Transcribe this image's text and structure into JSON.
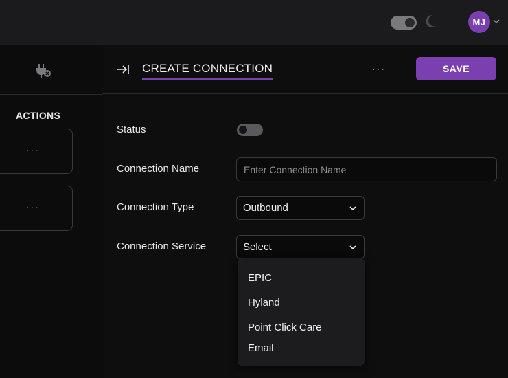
{
  "topbar": {
    "avatar_initials": "MJ"
  },
  "left_panel": {
    "actions_label": "ACTIONS",
    "cards": [
      {
        "dots": "···"
      },
      {
        "dots": "···"
      }
    ]
  },
  "main": {
    "title": "CREATE CONNECTION",
    "more_dots": "···",
    "save_label": "SAVE",
    "form": {
      "status_label": "Status",
      "status_enabled": false,
      "name_label": "Connection Name",
      "name_placeholder": "Enter Connection Name",
      "name_value": "",
      "type_label": "Connection Type",
      "type_value": "Outbound",
      "service_label": "Connection Service",
      "service_value": "Select"
    },
    "service_options": [
      "EPIC",
      "Hyland",
      "Point Click Care",
      "Email"
    ]
  },
  "colors": {
    "accent": "#7c3fb0",
    "background": "#1b1b1d",
    "panel": "#0e0e0f"
  },
  "icons": [
    "moon-icon",
    "chevron-down-icon",
    "plug-icon",
    "collapse-panel-icon"
  ]
}
